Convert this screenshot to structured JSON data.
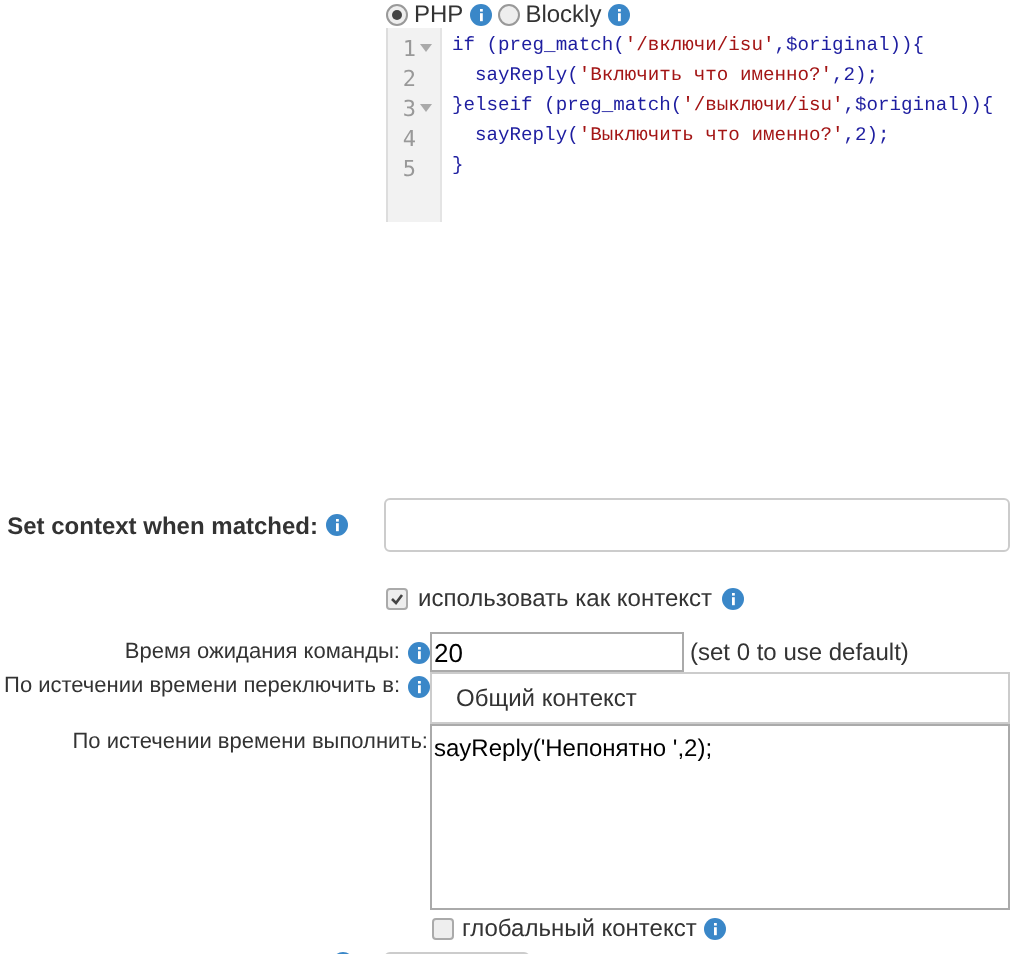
{
  "editor_mode": {
    "options": [
      {
        "label": "PHP",
        "selected": true
      },
      {
        "label": "Blockly",
        "selected": false
      }
    ]
  },
  "code_editor": {
    "lines": [
      {
        "number": "1",
        "foldable": true,
        "text": "if (preg_match('/включи/isu',$original)){"
      },
      {
        "number": "2",
        "foldable": false,
        "text": "  sayReply('Включить что именно?',2);"
      },
      {
        "number": "3",
        "foldable": true,
        "text": "}elseif (preg_match('/выключи/isu',$original)){"
      },
      {
        "number": "4",
        "foldable": false,
        "text": "  sayReply('Выключить что именно?',2);"
      },
      {
        "number": "5",
        "foldable": false,
        "text": "}"
      }
    ]
  },
  "set_context": {
    "label": "Set context when matched:"
  },
  "use_as_context": {
    "label": "использовать как контекст",
    "checked": true
  },
  "timeout": {
    "label": "Время ожидания команды:",
    "value": "20",
    "hint": "(set 0 to use default)"
  },
  "switch_to": {
    "label": "По истечении времени переключить в:",
    "value": "Общий контекст"
  },
  "execute": {
    "label": "По истечении времени выполнить:",
    "value": "sayReply('Непонятно ',2);"
  },
  "global_context": {
    "label": "глобальный контекст",
    "checked": false
  }
}
